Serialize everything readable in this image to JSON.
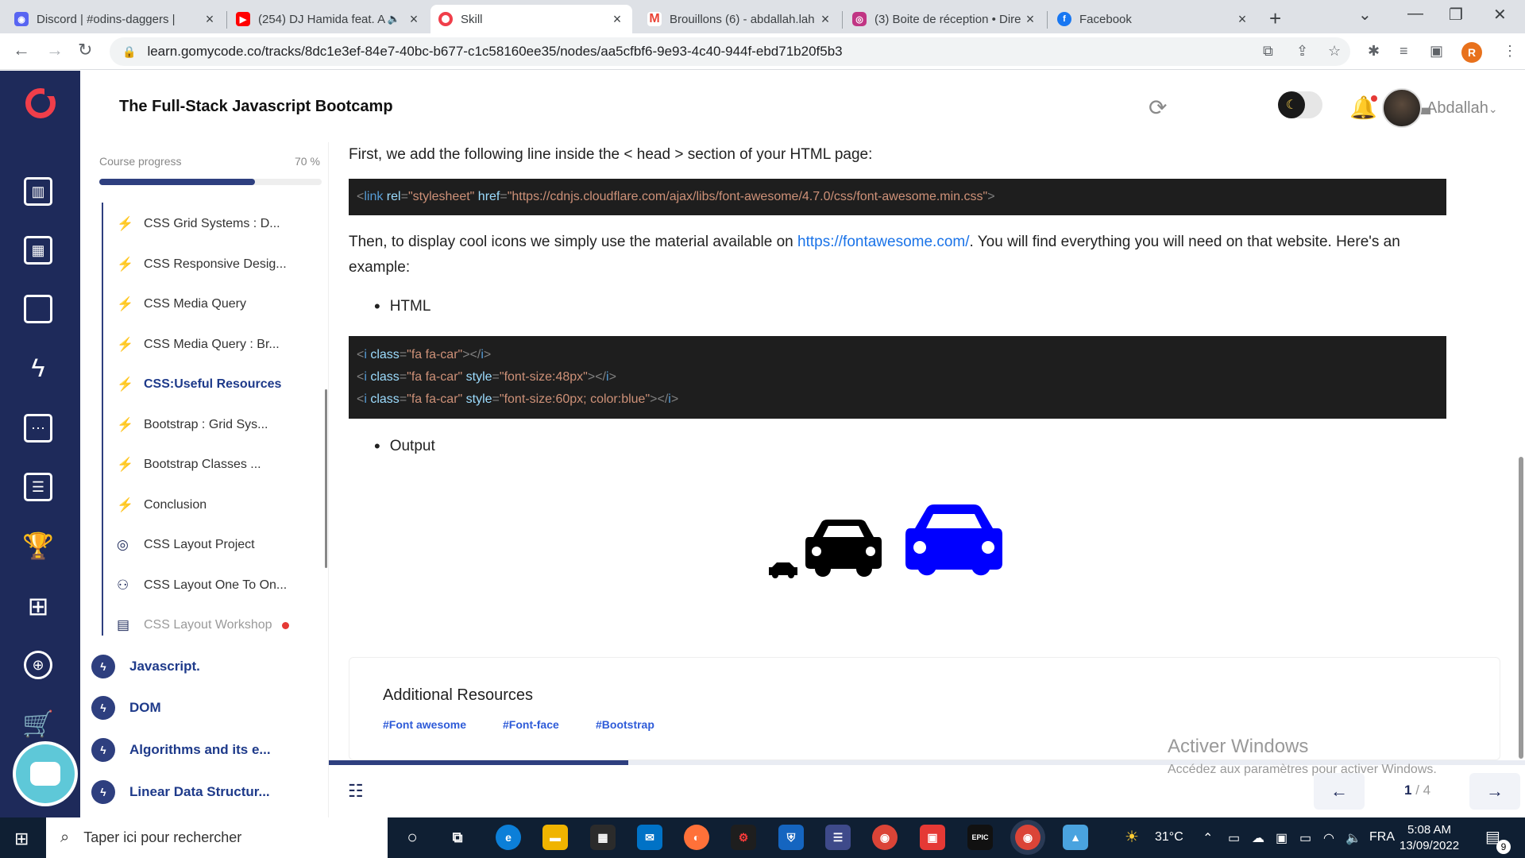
{
  "browser": {
    "tabs": [
      {
        "title": "Discord | #odins-daggers | ",
        "favicon": "discord-icon",
        "color": "#5865f2"
      },
      {
        "title": "(254) DJ Hamida feat. A",
        "favicon": "youtube-icon",
        "color": "#ff0000"
      },
      {
        "title": "Skill",
        "favicon": "gomycode-icon",
        "color": "#f03e4a"
      },
      {
        "title": "Brouillons (6) - abdallah.lah",
        "favicon": "gmail-icon",
        "color": "#ea4335"
      },
      {
        "title": "(3) Boite de réception • Dire",
        "favicon": "instagram-icon",
        "color": "#c13584"
      },
      {
        "title": "Facebook",
        "favicon": "facebook-icon",
        "color": "#1877f2"
      }
    ],
    "url": "learn.gomycode.co/tracks/8dc1e3ef-84e7-40bc-b677-c1c58160ee35/nodes/aa5cfbf6-9e93-4c40-944f-ebd71b20f5b3",
    "profile_initial": "R"
  },
  "header": {
    "course_title": "The Full-Stack Javascript Bootcamp",
    "username": "Abdallah"
  },
  "sidebar": {
    "progress_label": "Course progress",
    "progress_pct": "70 %",
    "progress_value": 0.7,
    "lessons": [
      {
        "label": "CSS Grid Systems : D...",
        "icon": "bolt-icon"
      },
      {
        "label": "CSS Responsive Desig...",
        "icon": "bolt-icon"
      },
      {
        "label": "CSS Media Query",
        "icon": "bolt-icon"
      },
      {
        "label": "CSS Media Query : Br...",
        "icon": "bolt-icon"
      },
      {
        "label": "CSS:Useful Resources",
        "icon": "bolt-icon"
      },
      {
        "label": "Bootstrap : Grid Sys...",
        "icon": "bolt-icon"
      },
      {
        "label": "Bootstrap Classes ...",
        "icon": "bolt-icon"
      },
      {
        "label": "Conclusion",
        "icon": "bolt-icon"
      },
      {
        "label": "CSS Layout Project",
        "icon": "target-icon"
      },
      {
        "label": "CSS Layout One To On...",
        "icon": "pair-icon"
      },
      {
        "label": "CSS Layout Workshop",
        "icon": "workshop-icon"
      }
    ],
    "modules": [
      {
        "label": "Javascript."
      },
      {
        "label": "DOM"
      },
      {
        "label": "Algorithms and its e..."
      },
      {
        "label": "Linear Data Structur..."
      }
    ]
  },
  "content": {
    "intro": "First, we add the following line inside the < head > section of your HTML page:",
    "code1": {
      "t1": "<",
      "tag": "link",
      "a1": " rel",
      "e1": "=",
      "v1": "\"stylesheet\"",
      "a2": "  href",
      "e2": "=",
      "v2": "\"https://cdnjs.cloudflare.com/ajax/libs/font-awesome/4.7.0/css/font-awesome.min.css\"",
      "t2": ">"
    },
    "para2_before": "Then, to display cool icons we simply use the material available on ",
    "para2_link": "https://fontawesome.com/",
    "para2_after": ". You will find everything you will need on that website. Here's an example:",
    "bullet_html": "HTML",
    "code2": [
      {
        "t1": "<",
        "tag": "i",
        "a1": " class",
        "e1": "=",
        "v1": "\"fa fa-car\"",
        "a2": "",
        "e2": "",
        "v2": "",
        "t2": "></",
        "tag2": "i",
        "t3": ">"
      },
      {
        "t1": "<",
        "tag": "i",
        "a1": " class",
        "e1": "=",
        "v1": "\"fa fa-car\"",
        "a2": " style",
        "e2": "=",
        "v2": "\"font-size:48px\"",
        "t2": "></",
        "tag2": "i",
        "t3": ">"
      },
      {
        "t1": "<",
        "tag": "i",
        "a1": " class",
        "e1": "=",
        "v1": "\"fa fa-car\"",
        "a2": " style",
        "e2": "=",
        "v2": "\"font-size:60px; color:blue\"",
        "t2": "></",
        "tag2": "i",
        "t3": ">"
      }
    ],
    "bullet_output": "Output",
    "resources_title": "Additional Resources",
    "resource_tags": [
      "#Font awesome",
      "#Font-face",
      "#Bootstrap"
    ]
  },
  "footer": {
    "page_current": "1",
    "page_total": "/ 4",
    "lesson_progress": 0.25
  },
  "watermark": {
    "line1": "Activer Windows",
    "line2": "Accédez aux paramètres pour activer Windows."
  },
  "taskbar": {
    "search_placeholder": "Taper ici pour rechercher",
    "weather": "31°C",
    "lang": "FRA",
    "time": "5:08 AM",
    "date": "13/09/2022",
    "notifications": "9"
  },
  "colors": {
    "rail": "#1e2a5a",
    "accent": "#2e3f7f",
    "brand": "#f03e4a",
    "car_blue": "#0000ff"
  }
}
